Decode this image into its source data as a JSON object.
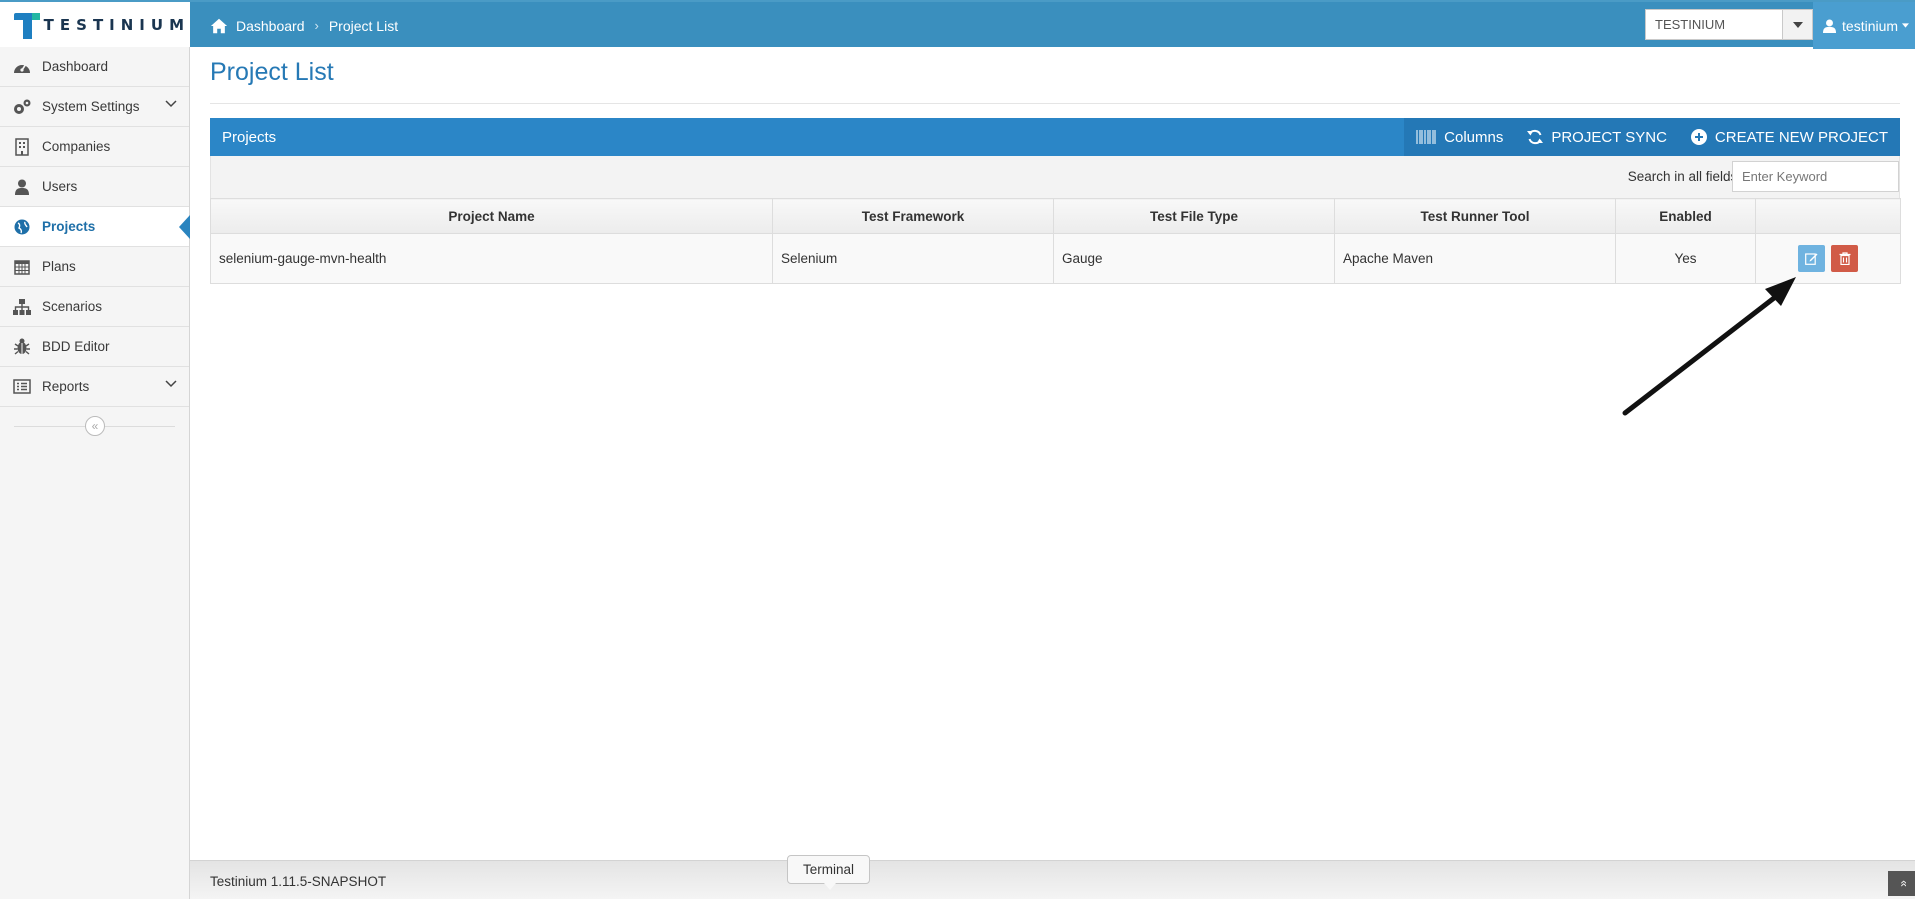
{
  "app": {
    "logo_text": "TESTINIUM"
  },
  "breadcrumb": {
    "items": [
      "Dashboard",
      "Project List"
    ]
  },
  "header": {
    "company_select_value": "TESTINIUM",
    "user_name": "testinium"
  },
  "sidebar": {
    "items": [
      {
        "label": "Dashboard",
        "icon": "tachometer-icon"
      },
      {
        "label": "System Settings",
        "icon": "cogs-icon",
        "has_submenu": true
      },
      {
        "label": "Companies",
        "icon": "building-icon"
      },
      {
        "label": "Users",
        "icon": "user-icon"
      },
      {
        "label": "Projects",
        "icon": "globe-icon",
        "active": true
      },
      {
        "label": "Plans",
        "icon": "calendar-icon"
      },
      {
        "label": "Scenarios",
        "icon": "sitemap-icon"
      },
      {
        "label": "BDD Editor",
        "icon": "bug-icon"
      },
      {
        "label": "Reports",
        "icon": "list-alt-icon",
        "has_submenu": true
      }
    ]
  },
  "main": {
    "page_title": "Project List",
    "panel": {
      "title": "Projects",
      "columns_label": "Columns",
      "sync_label": "PROJECT SYNC",
      "create_label": "CREATE NEW PROJECT"
    },
    "search": {
      "label": "Search in all fields:",
      "placeholder": "Enter Keyword",
      "value": ""
    },
    "table": {
      "headers": [
        "Project Name",
        "Test Framework",
        "Test File Type",
        "Test Runner Tool",
        "Enabled",
        ""
      ],
      "rows": [
        [
          "selenium-gauge-mvn-health",
          "Selenium",
          "Gauge",
          "Apache Maven",
          "Yes"
        ]
      ]
    }
  },
  "footer": {
    "version": "Testinium 1.11.5-SNAPSHOT",
    "terminal_label": "Terminal"
  },
  "colors": {
    "topbar": "#3a8fbe",
    "panel_header": "#2b86c7",
    "accent_title": "#2679b5",
    "edit_button": "#6fb3e0",
    "delete_button": "#d15b47"
  }
}
